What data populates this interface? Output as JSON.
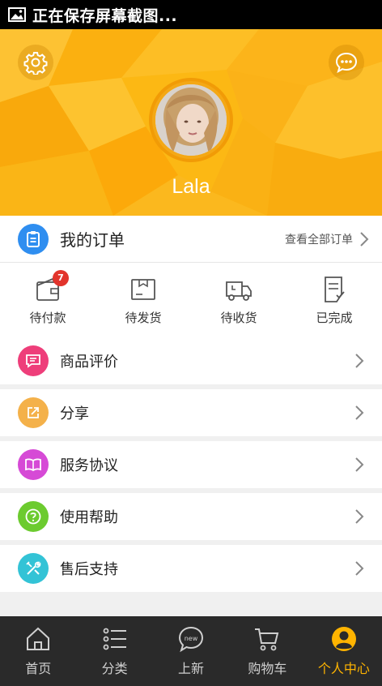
{
  "status_bar": {
    "text": "正在保存屏幕截图..."
  },
  "profile": {
    "username": "Lala"
  },
  "orders": {
    "title": "我的订单",
    "view_all": "查看全部订单",
    "statuses": [
      {
        "label": "待付款",
        "badge": "7",
        "icon": "wallet-icon"
      },
      {
        "label": "待发货",
        "icon": "package-icon"
      },
      {
        "label": "待收货",
        "icon": "truck-icon"
      },
      {
        "label": "已完成",
        "icon": "checklist-icon"
      }
    ]
  },
  "menu": [
    {
      "label": "商品评价",
      "icon": "comment-icon",
      "color": "#ee3e7a"
    },
    {
      "label": "分享",
      "icon": "share-icon",
      "color": "#f4b14a"
    },
    {
      "label": "服务协议",
      "icon": "book-icon",
      "color": "#d64ad6"
    },
    {
      "label": "使用帮助",
      "icon": "help-icon",
      "color": "#6ccb2f"
    },
    {
      "label": "售后支持",
      "icon": "tools-icon",
      "color": "#33c3d6"
    }
  ],
  "tabs": [
    {
      "label": "首页",
      "icon": "home-icon"
    },
    {
      "label": "分类",
      "icon": "list-icon"
    },
    {
      "label": "上新",
      "icon": "new-icon"
    },
    {
      "label": "购物车",
      "icon": "cart-icon"
    },
    {
      "label": "个人中心",
      "icon": "user-icon",
      "active": true
    }
  ],
  "colors": {
    "header": "#fcb814",
    "accent": "#ffb400",
    "tabbar": "#2a2a2a",
    "badge": "#e2342c",
    "orders_icon": "#2f8ef0"
  }
}
